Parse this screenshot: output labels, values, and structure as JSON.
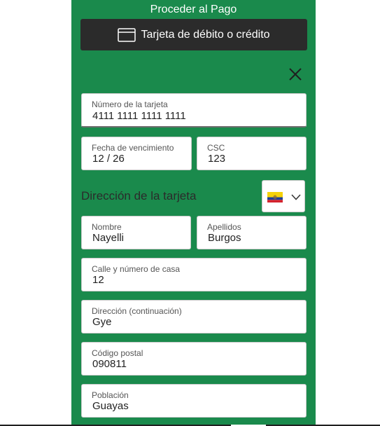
{
  "header": {
    "title": "Proceder al Pago"
  },
  "payment_method": {
    "label": "Tarjeta de débito o crédito",
    "icon": "credit-card-icon"
  },
  "close": {
    "icon": "close-icon"
  },
  "card": {
    "number_label": "Número de la tarjeta",
    "number_value": "4111 1111 1111 1111",
    "expiry_label": "Fecha de vencimiento",
    "expiry_value": "12 / 26",
    "csc_label": "CSC",
    "csc_value": "123"
  },
  "address": {
    "section_title": "Dirección de la tarjeta",
    "country_flag": "ecuador-flag-icon",
    "first_name_label": "Nombre",
    "first_name_value": "Nayelli",
    "last_name_label": "Apellidos",
    "last_name_value": "Burgos",
    "street_label": "Calle y número de casa",
    "street_value": "12",
    "street2_label": "Dirección (continuación)",
    "street2_value": "Gye",
    "postal_label": "Código postal",
    "postal_value": "090811",
    "city_label": "Población",
    "city_value": "Guayas"
  },
  "colors": {
    "panel": "#1a8a4c",
    "button": "#2b2b2b",
    "field_bg": "#ffffff"
  }
}
